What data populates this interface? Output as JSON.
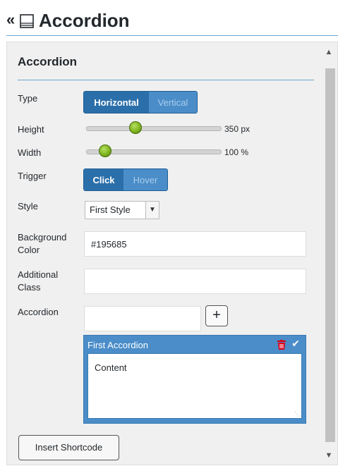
{
  "header": {
    "back_glyph": "«",
    "icon": "book-icon",
    "title": "Accordion"
  },
  "panel": {
    "section_title": "Accordion",
    "type": {
      "label": "Type",
      "options": [
        "Horizontal",
        "Vertical"
      ],
      "selected": "Horizontal"
    },
    "height": {
      "label": "Height",
      "value": 350,
      "value_text": "350 px",
      "level": 0.37
    },
    "width": {
      "label": "Width",
      "value": 100,
      "value_text": "100 %",
      "level": 0.14
    },
    "trigger": {
      "label": "Trigger",
      "options": [
        "Click",
        "Hover"
      ],
      "selected": "Click"
    },
    "style": {
      "label": "Style",
      "value": "First Style"
    },
    "background_color": {
      "label_line1": "Background",
      "label_line2": "Color",
      "value": "#195685"
    },
    "additional_class": {
      "label_line1": "Additional",
      "label_line2": "Class",
      "value": ""
    },
    "accordion": {
      "label": "Accordion",
      "new_input_value": "",
      "add_glyph": "+",
      "items": [
        {
          "title": "First Accordion",
          "content": "Content"
        }
      ]
    },
    "insert_button": "Insert Shortcode"
  },
  "colors": {
    "accent": "#2b6faa",
    "accent_light": "#4a8dc8",
    "slider_knob": "#7fb51f",
    "delete": "#d9001b"
  }
}
